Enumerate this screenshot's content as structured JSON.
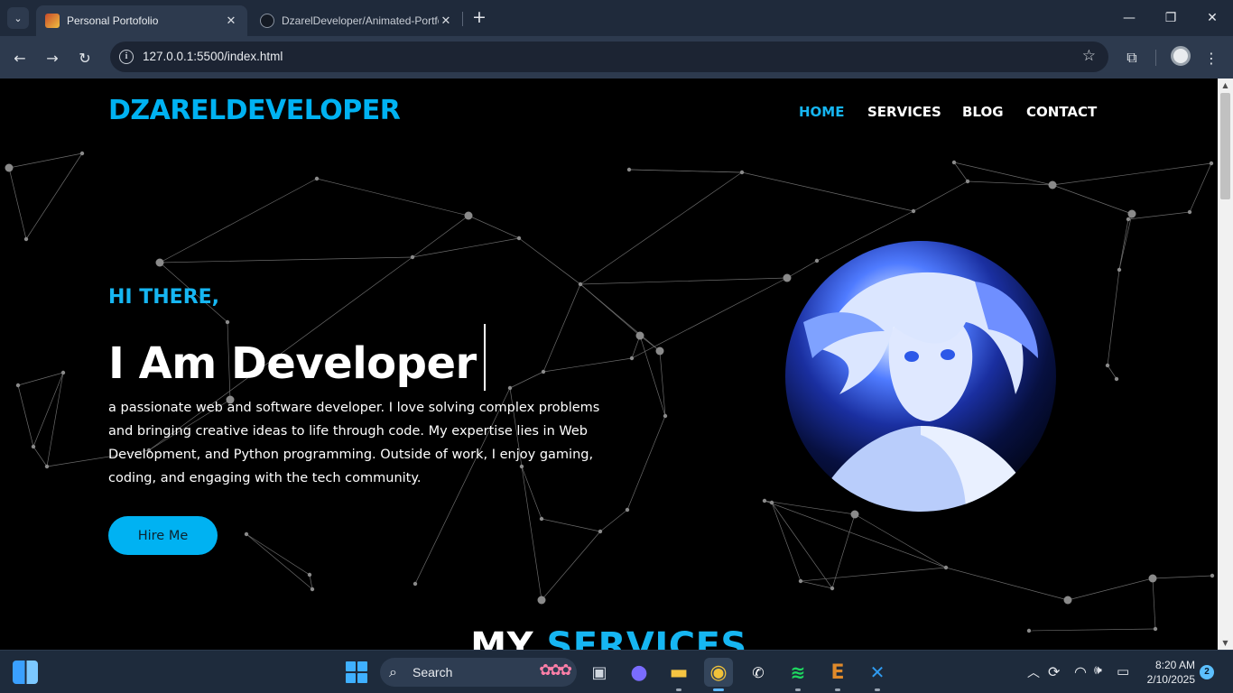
{
  "browser": {
    "tabs": [
      {
        "title": "Personal Portofolio",
        "close_icon": "✕"
      },
      {
        "title": "DzarelDeveloper/Animated-Portfolio",
        "close_icon": "✕"
      }
    ],
    "tab_menu_icon": "⌄",
    "new_tab_icon": "+",
    "window": {
      "minimize": "—",
      "restore": "❐",
      "close": "✕"
    },
    "nav": {
      "back": "←",
      "forward": "→",
      "reload": "↻"
    },
    "url": "127.0.0.1:5500/index.html",
    "site_info_icon": "i",
    "bookmark_icon": "☆",
    "extensions_icon": "⧉",
    "menu_icon": "⋮"
  },
  "site": {
    "brand": "DZARELDEVELOPER",
    "nav": [
      "HOME",
      "SERVICES",
      "BLOG",
      "CONTACT"
    ],
    "active_nav": "HOME",
    "greeting": "HI THERE,",
    "headline": "I Am Developer",
    "about": "a passionate web and software developer. I love solving complex problems and bringing creative ideas to life through code. My expertise lies in Web Development, and Python programming. Outside of work, I enjoy gaming, coding, and engaging with the tech community.",
    "cta": "Hire Me",
    "services_title_a": "MY ",
    "services_title_b": "SERVICES",
    "accent_color": "#00b2f2"
  },
  "scrollbar": {
    "up": "▲",
    "down": "▼"
  },
  "taskbar": {
    "search_placeholder": "Search",
    "search_icon": "⌕",
    "search_flowers": "✿✿✿",
    "apps": [
      {
        "name": "task-view",
        "glyph": "▣"
      },
      {
        "name": "meet",
        "glyph": "●"
      },
      {
        "name": "file-explorer",
        "glyph": "▬"
      },
      {
        "name": "chrome",
        "glyph": "◉"
      },
      {
        "name": "whatsapp",
        "glyph": "✆"
      },
      {
        "name": "spotify",
        "glyph": "≋"
      },
      {
        "name": "editor-e",
        "glyph": "E"
      },
      {
        "name": "vscode",
        "glyph": "✕"
      }
    ],
    "tray": {
      "chevron": "︿",
      "sync": "⟳",
      "wifi": "◠",
      "volume": "🕪",
      "battery": "▭"
    },
    "time": "8:20 AM",
    "date": "2/10/2025",
    "notifications": "2"
  }
}
